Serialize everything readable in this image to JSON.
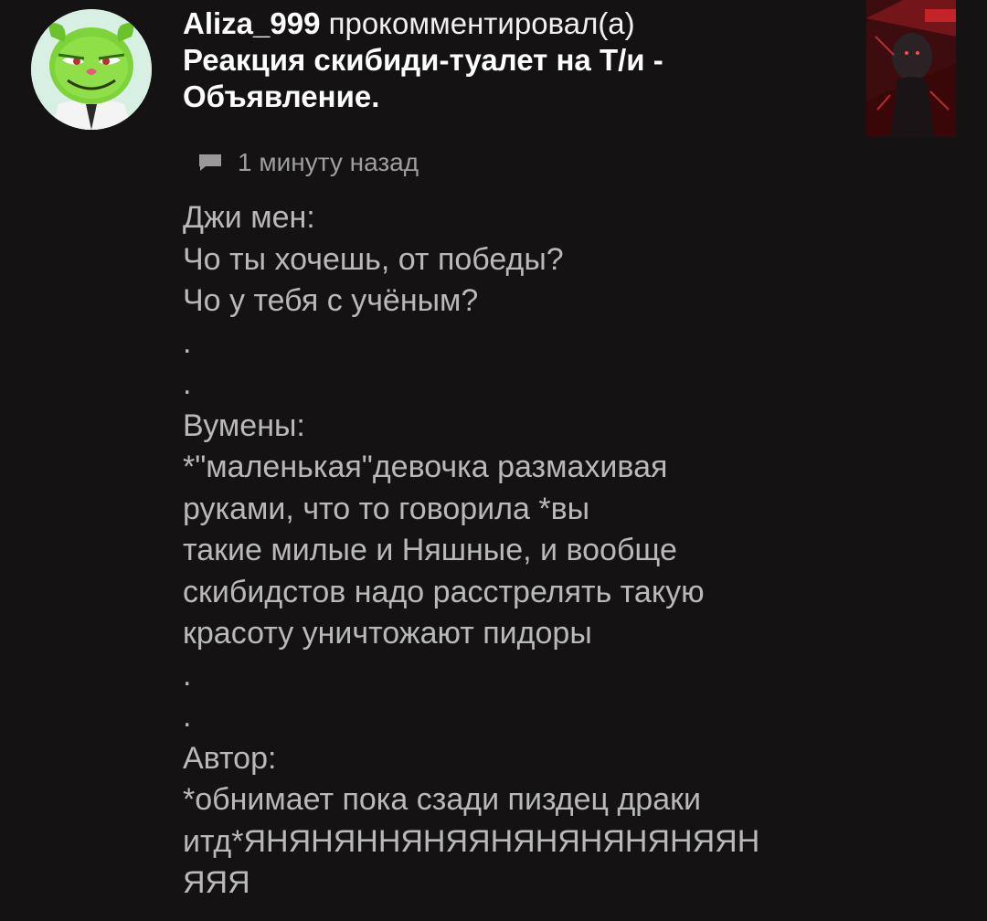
{
  "notification": {
    "user": "Aliza_999",
    "action": "прокомментировал(а)",
    "post_title": "Реакция скибиди-туалет на Т/и - Объявление.",
    "timestamp": "1 минуту назад",
    "icons": {
      "avatar": "green-cartoon-character-avatar",
      "thumbnail": "dark-red-post-thumbnail",
      "comment": "comment-bubble-icon"
    }
  },
  "comment": {
    "lines": [
      "Джи мен:",
      "Чо ты хочешь, от победы?",
      "Чо у тебя с учёным?",
      ".",
      ".",
      "Вумены:",
      "*\"маленькая\"девочка размахивая",
      "руками, что то говорила *вы",
      "такие милые и Няшные, и вообще",
      "скибидстов надо расстрелять такую",
      "красоту уничтожают пидоры",
      ".",
      ".",
      "Автор:",
      "*обнимает пока сзади пиздец драки",
      "итд*ЯНЯНЯННЯНЯЯНЯНЯНЯНЯНЯЯН",
      "ЯЯЯ"
    ]
  },
  "colors": {
    "background": "#141213",
    "title_text": "#ffffff",
    "body_text": "#b9b9b9",
    "meta_text": "#9e9e9e"
  }
}
